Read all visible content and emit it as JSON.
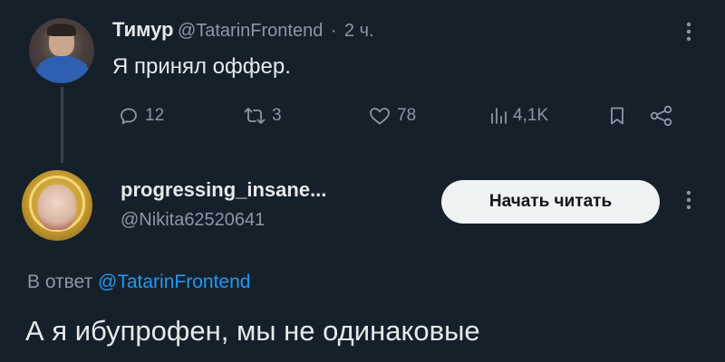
{
  "tweet1": {
    "author_name": "Тимур",
    "handle": "@TatarinFrontend",
    "separator": "·",
    "time": "2 ч.",
    "text": "Я принял оффер.",
    "reply_count": "12",
    "retweet_count": "3",
    "like_count": "78",
    "view_count": "4,1K"
  },
  "tweet2": {
    "author_name": "progressing_insane...",
    "handle": "@Nikita62520641",
    "follow_label": "Начать читать",
    "reply_prefix": "В ответ",
    "reply_mention": "@TatarinFrontend",
    "text": "А я ибупрофен,  мы не одинаковые"
  },
  "icons": {
    "reply": "reply-icon",
    "retweet": "retweet-icon",
    "like": "heart-icon",
    "views": "views-chart-icon",
    "bookmark": "bookmark-icon",
    "share": "share-icon",
    "more": "more-vertical-icon"
  },
  "colors": {
    "background": "#15202b",
    "text_primary": "#e7e9ea",
    "text_secondary": "#8b98a5",
    "accent": "#1d9bf0",
    "button_bg": "#eff3f4"
  }
}
